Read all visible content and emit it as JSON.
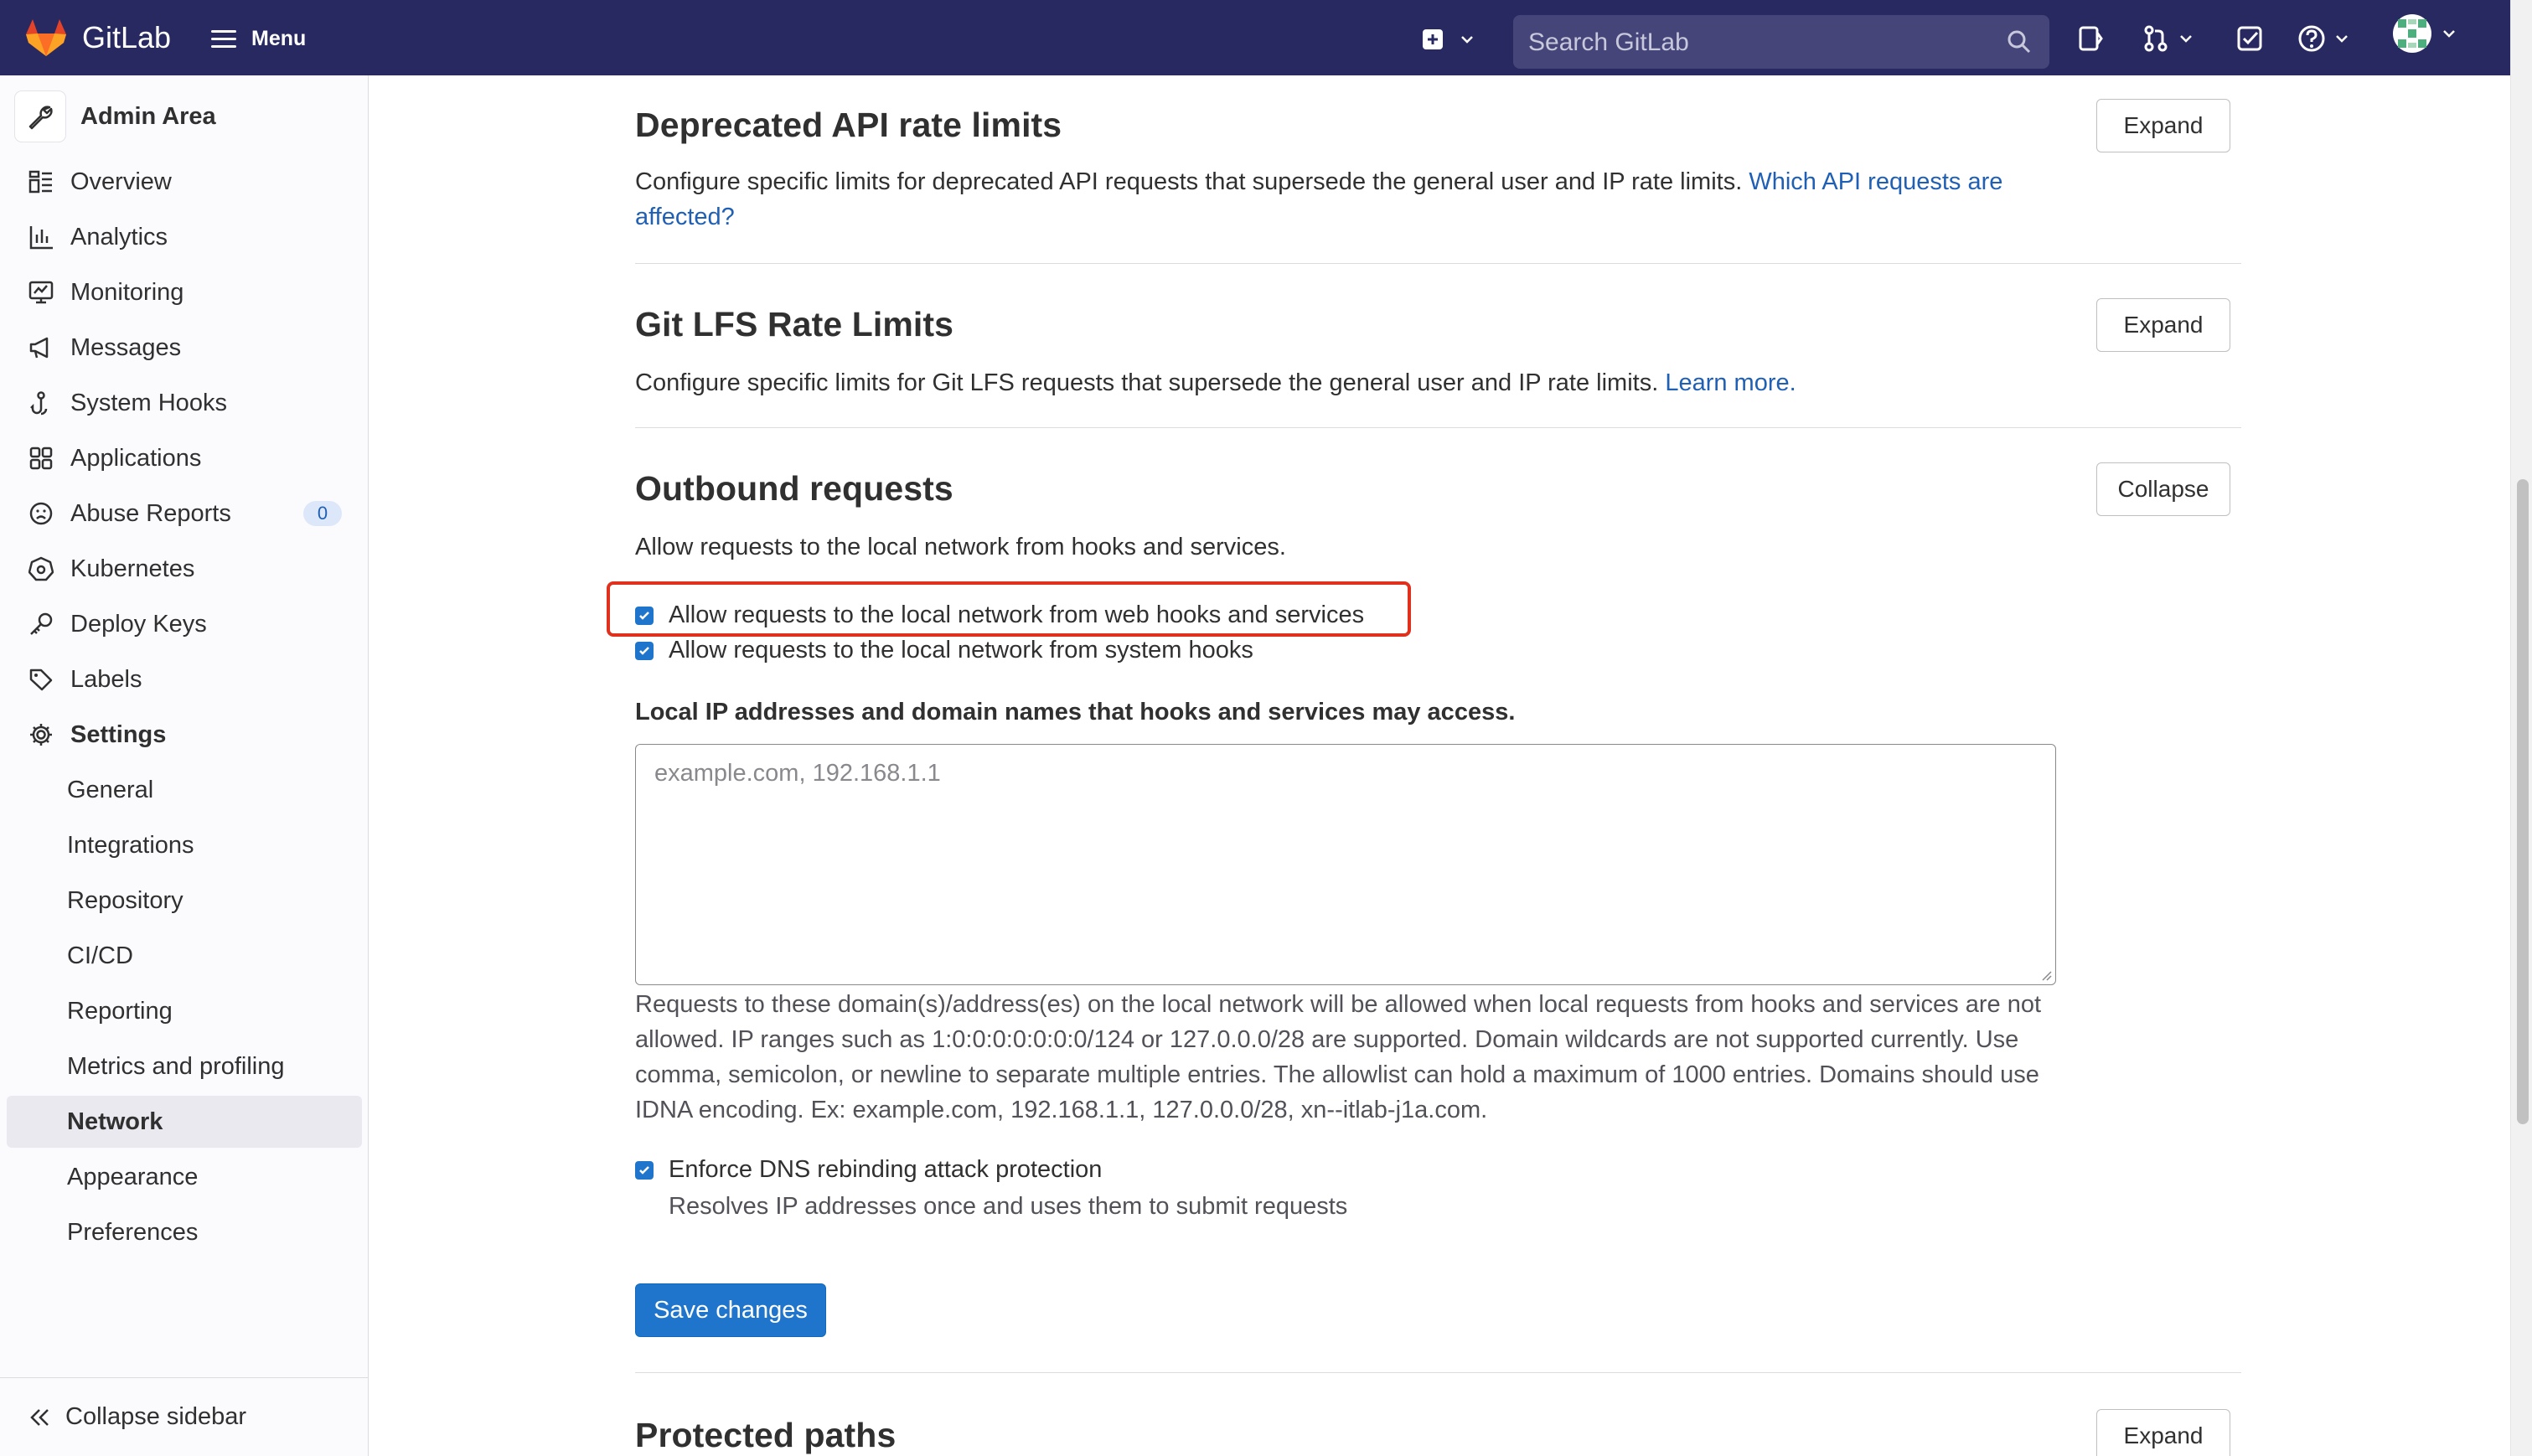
{
  "app": {
    "brand": "GitLab",
    "menu_label": "Menu"
  },
  "header": {
    "search_placeholder": "Search GitLab"
  },
  "sidebar": {
    "title": "Admin Area",
    "items": [
      {
        "label": "Overview",
        "icon": "overview-icon"
      },
      {
        "label": "Analytics",
        "icon": "analytics-icon"
      },
      {
        "label": "Monitoring",
        "icon": "monitoring-icon"
      },
      {
        "label": "Messages",
        "icon": "messages-icon"
      },
      {
        "label": "System Hooks",
        "icon": "hook-icon"
      },
      {
        "label": "Applications",
        "icon": "applications-icon"
      },
      {
        "label": "Abuse Reports",
        "icon": "abuse-icon",
        "badge": "0"
      },
      {
        "label": "Kubernetes",
        "icon": "kubernetes-icon"
      },
      {
        "label": "Deploy Keys",
        "icon": "key-icon"
      },
      {
        "label": "Labels",
        "icon": "label-icon"
      },
      {
        "label": "Settings",
        "icon": "settings-icon"
      }
    ],
    "settings_sub": [
      {
        "label": "General"
      },
      {
        "label": "Integrations"
      },
      {
        "label": "Repository"
      },
      {
        "label": "CI/CD"
      },
      {
        "label": "Reporting"
      },
      {
        "label": "Metrics and profiling"
      },
      {
        "label": "Network",
        "active": true
      },
      {
        "label": "Appearance"
      },
      {
        "label": "Preferences"
      }
    ],
    "collapse_label": "Collapse sidebar"
  },
  "sections": {
    "deprecated": {
      "title": "Deprecated API rate limits",
      "button": "Expand",
      "desc": "Configure specific limits for deprecated API requests that supersede the general user and IP rate limits. ",
      "link": "Which API requests are affected?"
    },
    "lfs": {
      "title": "Git LFS Rate Limits",
      "button": "Expand",
      "desc": "Configure specific limits for Git LFS requests that supersede the general user and IP rate limits. ",
      "link": "Learn more."
    },
    "outbound": {
      "title": "Outbound requests",
      "button": "Collapse",
      "desc": "Allow requests to the local network from hooks and services.",
      "cb_web": "Allow requests to the local network from web hooks and services",
      "cb_system": "Allow requests to the local network from system hooks",
      "field_label": "Local IP addresses and domain names that hooks and services may access.",
      "textarea_placeholder": "example.com, 192.168.1.1",
      "help": "Requests to these domain(s)/address(es) on the local network will be allowed when local requests from hooks and services are not allowed. IP ranges such as 1:0:0:0:0:0:0:0/124 or 127.0.0.0/28 are supported. Domain wildcards are not supported currently. Use comma, semicolon, or newline to separate multiple entries. The allowlist can hold a maximum of 1000 entries. Domains should use IDNA encoding. Ex: example.com, 192.168.1.1, 127.0.0.0/28, xn--itlab-j1a.com.",
      "cb_dns": "Enforce DNS rebinding attack protection",
      "cb_dns_help": "Resolves IP addresses once and uses them to submit requests",
      "save": "Save changes"
    },
    "protected": {
      "title": "Protected paths",
      "button": "Expand"
    }
  },
  "colors": {
    "topbar": "#292961",
    "primary": "#1f75cb",
    "link": "#1f5fb4",
    "highlight": "#e0311f"
  }
}
